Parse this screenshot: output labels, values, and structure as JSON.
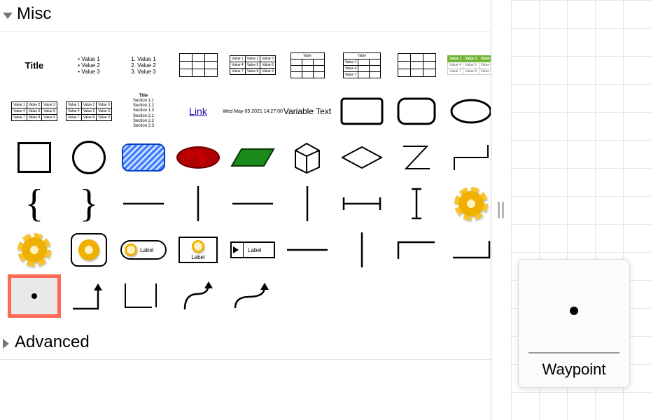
{
  "sections": {
    "misc": {
      "title": "Misc",
      "expanded": true
    },
    "advanced": {
      "title": "Advanced",
      "expanded": false
    }
  },
  "tooltip": {
    "label": "Waypoint"
  },
  "shapes": {
    "title_text": "Title",
    "bullet_values": [
      "Value 1",
      "Value 2",
      "Value 3"
    ],
    "numbered_values": [
      "1. Value 1",
      "2. Value 2",
      "3. Value 3"
    ],
    "link_text": "Link",
    "timestamp_text": "Wed May 05 2021 14:27:00",
    "variable_text": "Variable Text",
    "label_text": "Label",
    "table_text_cells": [
      [
        "Value 1",
        "Value 2",
        "Value 3"
      ],
      [
        "Value 4",
        "Value 5",
        "Value 6"
      ],
      [
        "Value 7",
        "Value 8",
        "Value 9"
      ]
    ],
    "table_header": "Table",
    "section_list": {
      "title": "Title",
      "items": [
        "Section 1.1",
        "Section 1.2",
        "Section 1.3",
        "Section 2.1",
        "Section 2.2",
        "Section 2.3"
      ]
    }
  },
  "selected_shape": "waypoint"
}
